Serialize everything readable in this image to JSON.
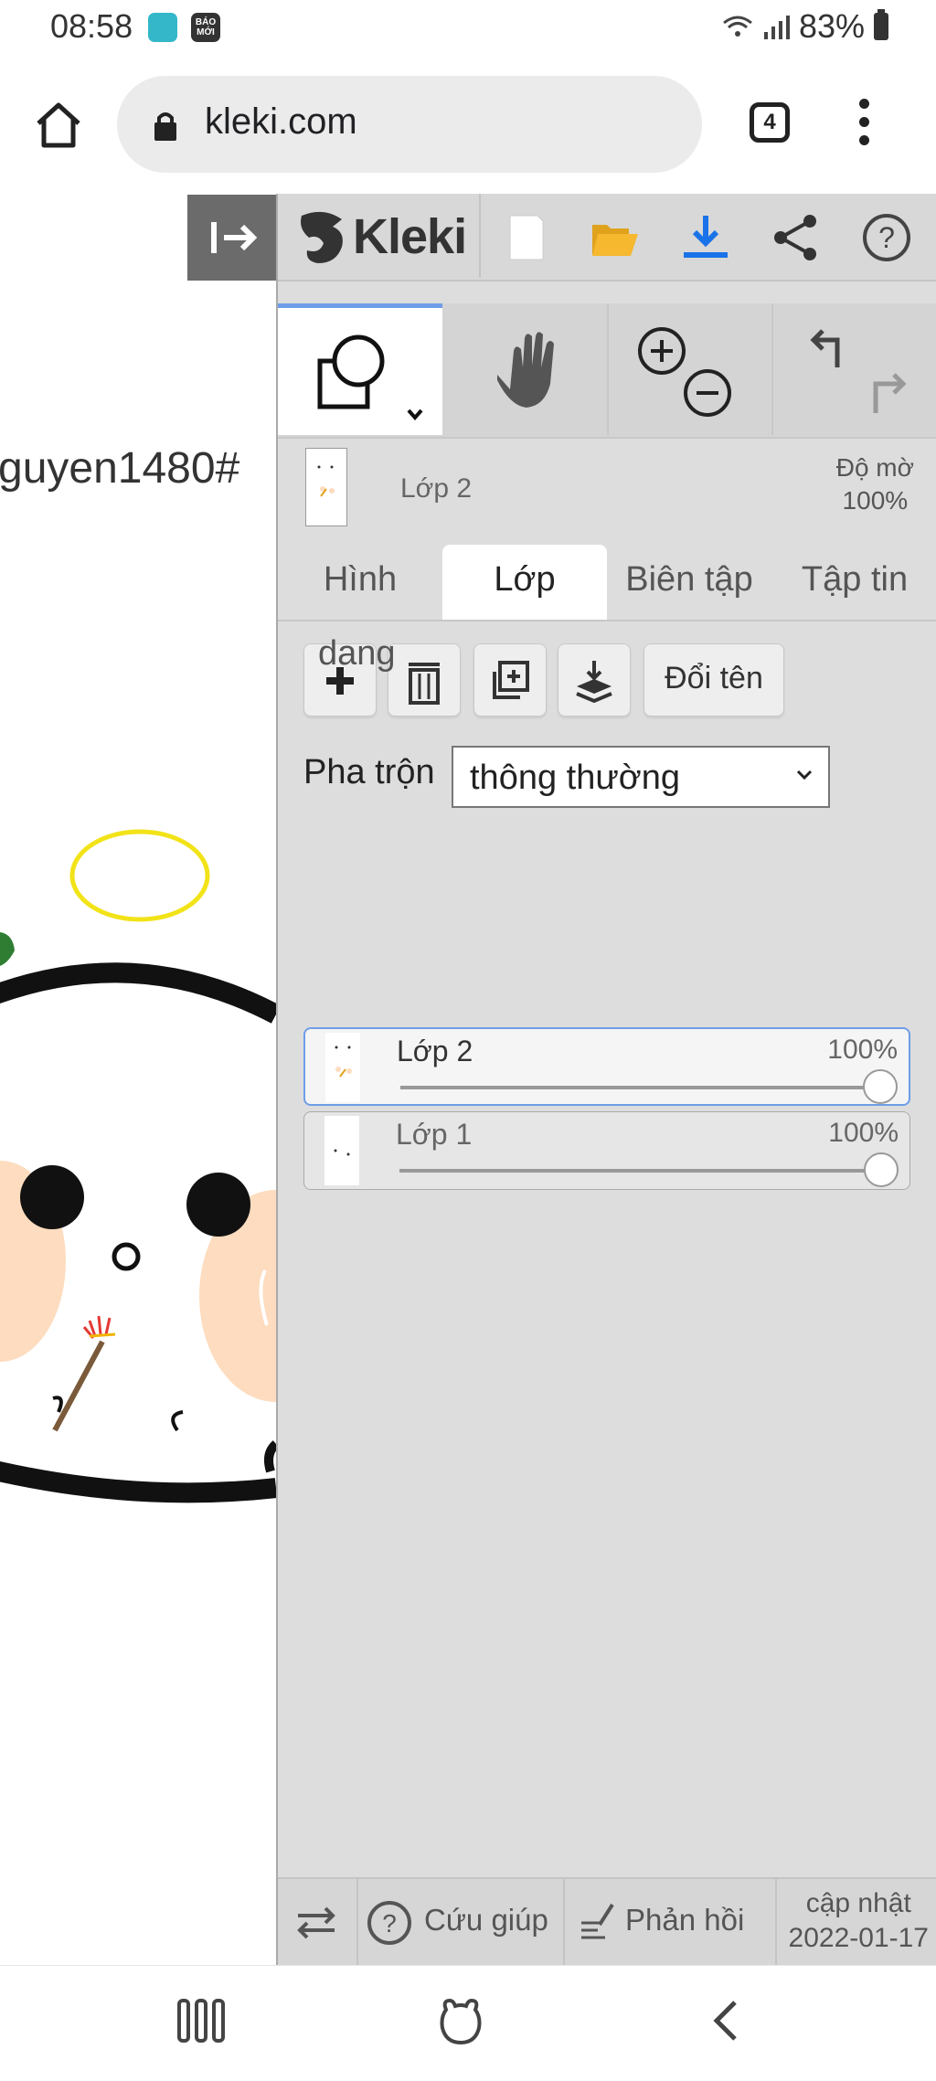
{
  "status_bar": {
    "time": "08:58",
    "app2_label": "BÁO MỚI",
    "battery": "83%"
  },
  "browser": {
    "url": "kleki.com",
    "tab_count": "4"
  },
  "canvas": {
    "partial_text": "guyen1480#"
  },
  "app": {
    "logo_text": "Kleki",
    "layer_info": {
      "name": "Lớp 2",
      "opacity_label": "Độ mờ",
      "opacity_value": "100%"
    },
    "tabs": [
      {
        "label": "Hình"
      },
      {
        "label": "Lớp"
      },
      {
        "label": "Biên tập"
      },
      {
        "label": "Tập tin"
      }
    ],
    "layers_panel": {
      "overlay_text": "dang",
      "rename_label": "Đổi tên",
      "blend_label": "Pha trộn",
      "blend_value": "thông thường",
      "layers": [
        {
          "name": "Lớp 2",
          "opacity": "100%",
          "opacity_fraction": 1.0,
          "active": true
        },
        {
          "name": "Lớp 1",
          "opacity": "100%",
          "opacity_fraction": 1.0,
          "active": false
        }
      ]
    },
    "footer": {
      "help_label": "Cứu giúp",
      "feedback_label": "Phản hồi",
      "update_label": "cập nhật",
      "update_date": "2022-01-17"
    }
  },
  "colors": {
    "accent": "#6f9de8",
    "panel_bg": "#dddddd",
    "open_folder": "#f5b82e",
    "download": "#1a73e8",
    "halo": "#f2e318",
    "leaf": "#2e7d32",
    "cheek": "#fddcbf"
  },
  "icons": [
    "home-icon",
    "lock-icon",
    "tabs-icon",
    "more-icon",
    "collapse-sidebar-icon",
    "kleki-logo-icon",
    "new-image-icon",
    "open-folder-icon",
    "download-icon",
    "share-icon",
    "help-icon",
    "shape-tool-icon",
    "hand-tool-icon",
    "zoom-in-icon",
    "zoom-out-icon",
    "undo-icon",
    "redo-icon",
    "add-layer-icon",
    "delete-layer-icon",
    "duplicate-layer-icon",
    "merge-down-icon",
    "swap-sides-icon",
    "feedback-icon",
    "recent-apps-icon",
    "home-bear-icon",
    "back-icon"
  ]
}
